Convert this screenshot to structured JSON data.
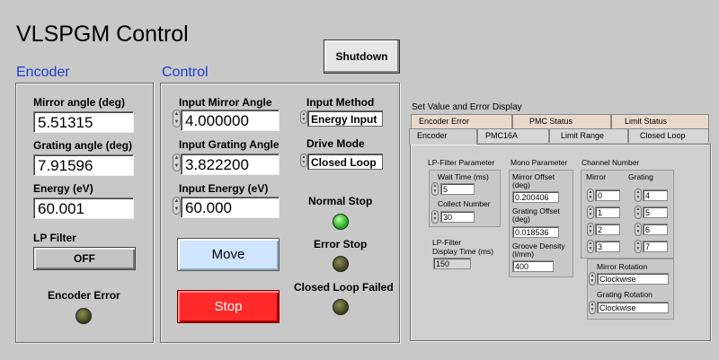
{
  "title": "VLSPGM Control",
  "shutdown_label": "Shutdown",
  "encoder": {
    "title": "Encoder",
    "mirror_angle_label": "Mirror angle (deg)",
    "mirror_angle_value": "5.51315",
    "grating_angle_label": "Grating angle (deg)",
    "grating_angle_value": "7.91596",
    "energy_label": "Energy (eV)",
    "energy_value": "60.001",
    "lp_filter_label": "LP Filter",
    "lp_filter_button": "OFF",
    "encoder_error_label": "Encoder Error"
  },
  "control": {
    "title": "Control",
    "input_mirror_angle_label": "Input Mirror Angle",
    "input_mirror_angle_value": "4.000000",
    "input_grating_angle_label": "Input Grating Angle",
    "input_grating_angle_value": "3.822200",
    "input_energy_label": "Input Energy (eV)",
    "input_energy_value": "60.000",
    "input_method_label": "Input Method",
    "input_method_value": "Energy Input",
    "drive_mode_label": "Drive Mode",
    "drive_mode_value": "Closed Loop",
    "normal_stop_label": "Normal Stop",
    "error_stop_label": "Error Stop",
    "closed_loop_failed_label": "Closed Loop Failed",
    "move_label": "Move",
    "stop_label": "Stop"
  },
  "display": {
    "title": "Set Value and Error Display",
    "tabs_back": [
      "Encoder Error",
      "PMC Status",
      "Limit Status"
    ],
    "tabs_front": [
      "Encoder",
      "PMC16A",
      "Limit Range",
      "Closed Loop"
    ],
    "lp": {
      "title": "LP-Filter Parameter",
      "wait_time_label": "Wait Time (ms)",
      "wait_time_value": "5",
      "collect_number_label": "Collect Number",
      "collect_number_value": "30",
      "display_time_label_1": "LP-Filter",
      "display_time_label_2": "Display Time (ms)",
      "display_time_value": "150"
    },
    "mono": {
      "title": "Mono Parameter",
      "mirror_offset_label_1": "Mirror Offset",
      "mirror_offset_label_2": "(deg)",
      "mirror_offset_value": "0.200406",
      "grating_offset_label_1": "Grating Offset",
      "grating_offset_label_2": "(deg)",
      "grating_offset_value": "0.018536",
      "groove_density_label_1": "Groove Density",
      "groove_density_label_2": "(l/mm)",
      "groove_density_value": "400"
    },
    "channel": {
      "title": "Channel Number",
      "mirror_label": "Mirror",
      "grating_label": "Grating",
      "mirror_values": [
        "0",
        "1",
        "2",
        "3"
      ],
      "grating_values": [
        "4",
        "5",
        "6",
        "7"
      ],
      "mirror_rotation_label": "Mirror Rotation",
      "mirror_rotation_value": "Clockwise",
      "grating_rotation_label": "Grating Rotation",
      "grating_rotation_value": "Clockwise"
    }
  },
  "colors": {
    "background": "#c8c8c8",
    "section_title": "#1a3fcf",
    "move_button": "#cfe4ff",
    "stop_button": "#ff2a2a",
    "led_on": "#1fa81f",
    "led_off": "#3d3d18"
  }
}
